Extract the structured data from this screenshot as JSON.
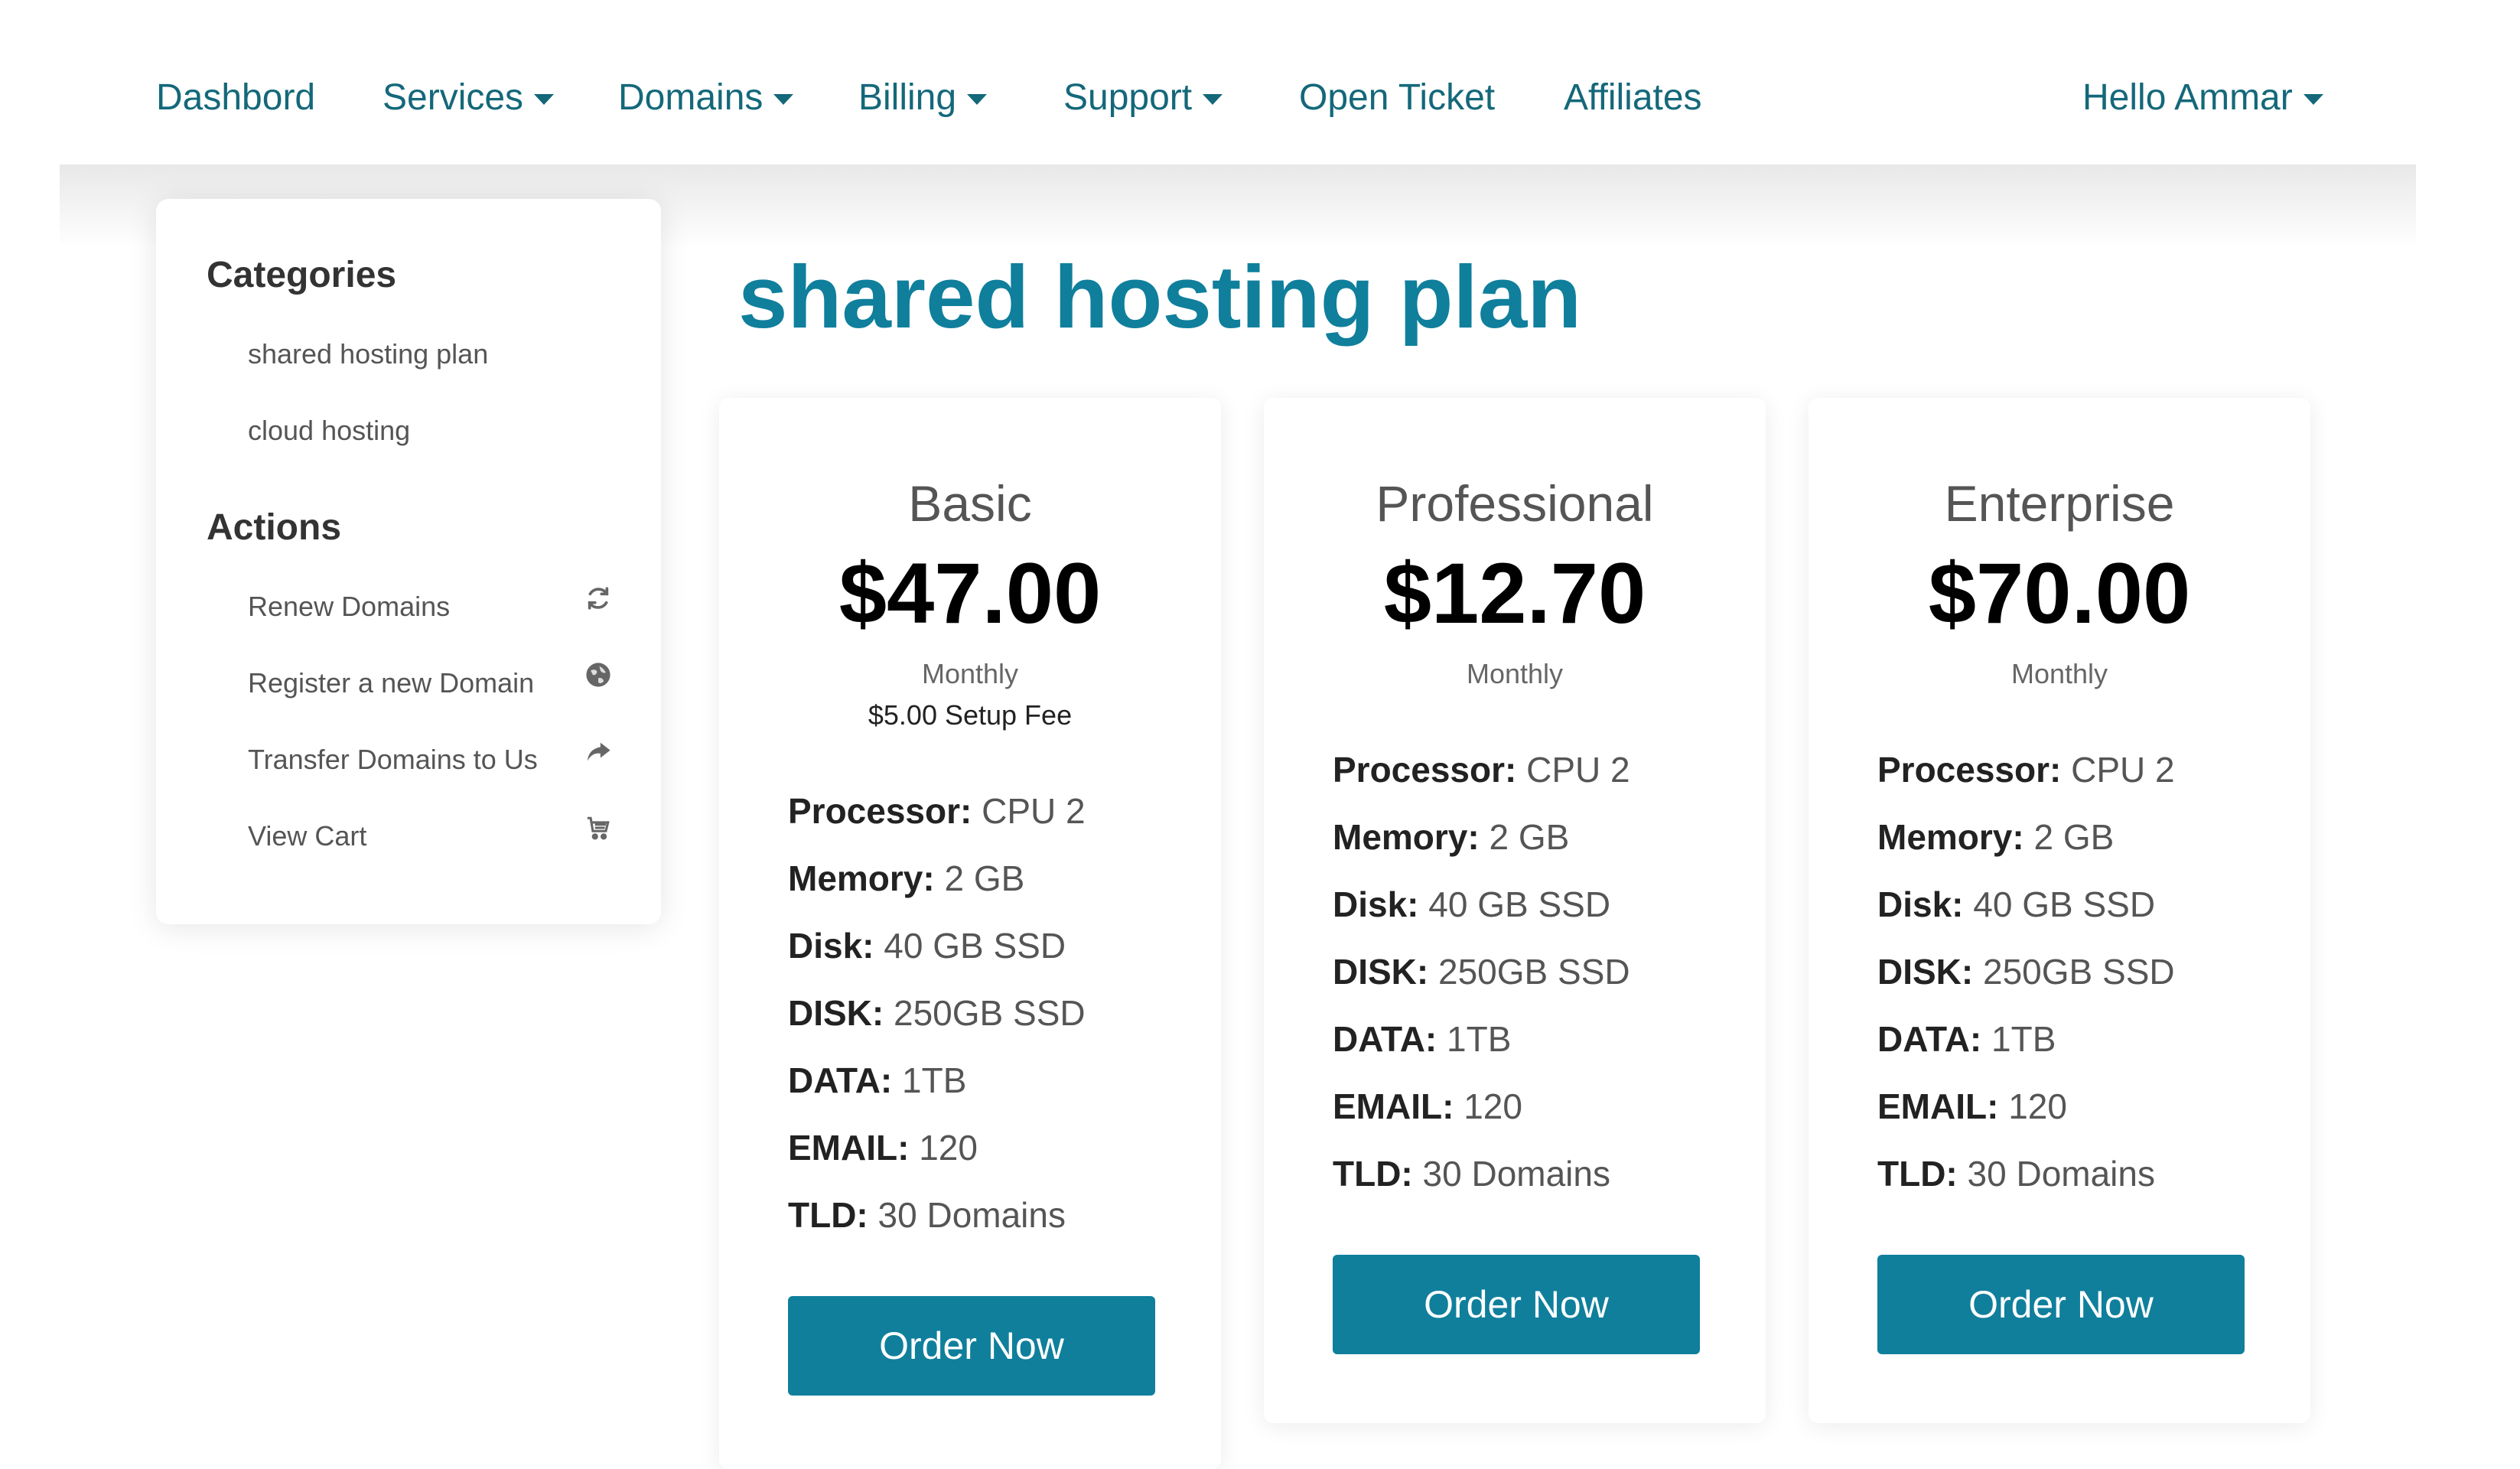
{
  "nav": {
    "items": [
      {
        "label": "Dashbord",
        "dropdown": false
      },
      {
        "label": "Services",
        "dropdown": true
      },
      {
        "label": "Domains",
        "dropdown": true
      },
      {
        "label": "Billing",
        "dropdown": true
      },
      {
        "label": "Support",
        "dropdown": true
      },
      {
        "label": "Open Ticket",
        "dropdown": false
      },
      {
        "label": "Affiliates",
        "dropdown": false
      }
    ],
    "user_menu": "Hello Ammar"
  },
  "sidebar": {
    "categories_heading": "Categories",
    "categories": [
      "shared hosting plan",
      "cloud hosting"
    ],
    "actions_heading": "Actions",
    "actions": [
      {
        "label": "Renew Domains",
        "icon": "refresh-icon"
      },
      {
        "label": "Register a new Domain",
        "icon": "globe-icon"
      },
      {
        "label": "Transfer Domains to Us",
        "icon": "share-icon"
      },
      {
        "label": "View Cart",
        "icon": "cart-icon"
      }
    ]
  },
  "main": {
    "title": "shared hosting plan",
    "plans": [
      {
        "name": "Basic",
        "price": "$47.00",
        "cycle": "Monthly",
        "setup_fee": "$5.00 Setup Fee",
        "features": [
          {
            "label": "Processor:",
            "value": "CPU 2"
          },
          {
            "label": "Memory:",
            "value": "2 GB"
          },
          {
            "label": "Disk:",
            "value": "40 GB SSD"
          },
          {
            "label": "DISK:",
            "value": "250GB SSD"
          },
          {
            "label": "DATA:",
            "value": "1TB"
          },
          {
            "label": "EMAIL:",
            "value": "120"
          },
          {
            "label": "TLD:",
            "value": "30 Domains"
          }
        ],
        "button": "Order Now"
      },
      {
        "name": "Professional",
        "price": "$12.70",
        "cycle": "Monthly",
        "features": [
          {
            "label": "Processor:",
            "value": "CPU 2"
          },
          {
            "label": "Memory:",
            "value": "2 GB"
          },
          {
            "label": "Disk:",
            "value": "40 GB SSD"
          },
          {
            "label": "DISK:",
            "value": "250GB SSD"
          },
          {
            "label": "DATA:",
            "value": "1TB"
          },
          {
            "label": "EMAIL:",
            "value": "120"
          },
          {
            "label": "TLD:",
            "value": "30 Domains"
          }
        ],
        "button": "Order Now"
      },
      {
        "name": "Enterprise",
        "price": "$70.00",
        "cycle": "Monthly",
        "features": [
          {
            "label": "Processor:",
            "value": "CPU 2"
          },
          {
            "label": "Memory:",
            "value": "2 GB"
          },
          {
            "label": "Disk:",
            "value": "40 GB SSD"
          },
          {
            "label": "DISK:",
            "value": "250GB SSD"
          },
          {
            "label": "DATA:",
            "value": "1TB"
          },
          {
            "label": "EMAIL:",
            "value": "120"
          },
          {
            "label": "TLD:",
            "value": "30 Domains"
          }
        ],
        "button": "Order Now"
      }
    ]
  },
  "colors": {
    "nav_text": "#14687a",
    "accent": "#0f7f9c",
    "button_text": "#ffffff"
  }
}
